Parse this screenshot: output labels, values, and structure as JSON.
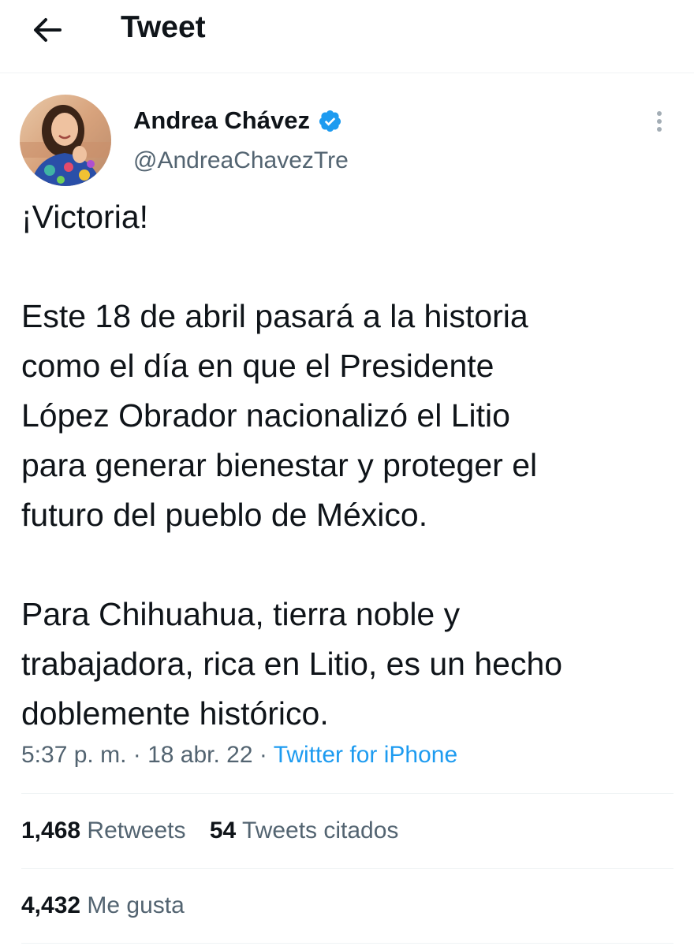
{
  "header": {
    "title": "Tweet",
    "back_icon": "arrow-left-icon"
  },
  "author": {
    "name": "Andrea Chávez",
    "handle": "@AndreaChavezTre",
    "verified": true,
    "verified_icon": "verified-badge-icon",
    "more_icon": "more-vertical-icon"
  },
  "tweet": {
    "paragraphs": [
      "¡Victoria!",
      "Este 18 de abril pasará a la historia\ncomo el día en que el Presidente\nLópez Obrador nacionalizó el Litio\npara generar bienestar y proteger el\nfuturo del pueblo de México.",
      "Para Chihuahua, tierra noble y\ntrabajadora, rica en Litio, es un hecho\ndoblemente histórico."
    ],
    "time": "5:37 p. m.",
    "date": "18 abr. 22",
    "separator": "·",
    "source": "Twitter for iPhone"
  },
  "stats": {
    "retweets_count": "1,468",
    "retweets_label": "Retweets",
    "quotes_count": "54",
    "quotes_label": "Tweets citados",
    "likes_count": "4,432",
    "likes_label": "Me gusta"
  },
  "colors": {
    "text": "#0f1419",
    "secondary": "#536471",
    "accent": "#1d9bf0",
    "divider": "#eff3f4"
  }
}
